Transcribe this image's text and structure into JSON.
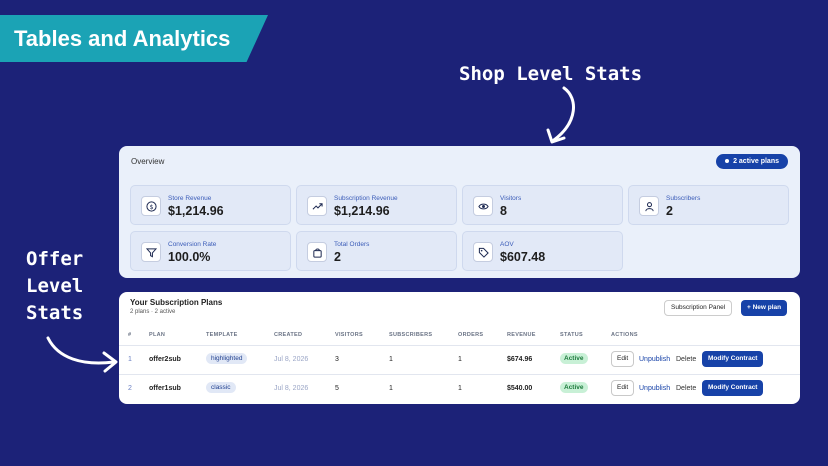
{
  "banner": {
    "title": "Tables and Analytics"
  },
  "annotations": {
    "shop": "Shop Level Stats",
    "offer_lines": [
      "Offer",
      "Level",
      "Stats"
    ]
  },
  "overview": {
    "title": "Overview",
    "active_badge": "2 active plans",
    "stats": [
      {
        "label": "Store Revenue",
        "value": "$1,214.96",
        "icon": "dollar-icon"
      },
      {
        "label": "Subscription Revenue",
        "value": "$1,214.96",
        "icon": "trend-up-icon"
      },
      {
        "label": "Visitors",
        "value": "8",
        "icon": "eye-icon"
      },
      {
        "label": "Subscribers",
        "value": "2",
        "icon": "user-icon"
      },
      {
        "label": "Conversion Rate",
        "value": "100.0%",
        "icon": "funnel-icon"
      },
      {
        "label": "Total Orders",
        "value": "2",
        "icon": "bag-icon"
      },
      {
        "label": "AOV",
        "value": "$607.48",
        "icon": "tag-icon"
      }
    ]
  },
  "plans": {
    "title": "Your Subscription Plans",
    "subtitle": "2 plans · 2 active",
    "panel_button": "Subscription Panel",
    "new_button": "+ New plan",
    "columns": [
      "#",
      "PLAN",
      "TEMPLATE",
      "CREATED",
      "VISITORS",
      "SUBSCRIBERS",
      "ORDERS",
      "REVENUE",
      "STATUS",
      "ACTIONS"
    ],
    "rows": [
      {
        "idx": "1",
        "plan": "offer2sub",
        "template": "highlighted",
        "created": "Jul 8, 2026",
        "visitors": "3",
        "subscribers": "1",
        "orders": "1",
        "revenue": "$674.96",
        "status": "Active"
      },
      {
        "idx": "2",
        "plan": "offer1sub",
        "template": "classic",
        "created": "Jul 8, 2026",
        "visitors": "5",
        "subscribers": "1",
        "orders": "1",
        "revenue": "$540.00",
        "status": "Active"
      }
    ],
    "actions": {
      "edit": "Edit",
      "unpublish": "Unpublish",
      "delete": "Delete",
      "modify": "Modify Contract"
    }
  },
  "colors": {
    "background": "#1c2278",
    "banner": "#1ba3b5",
    "primary": "#1742a8",
    "active_badge_bg": "#c8f0d6"
  }
}
